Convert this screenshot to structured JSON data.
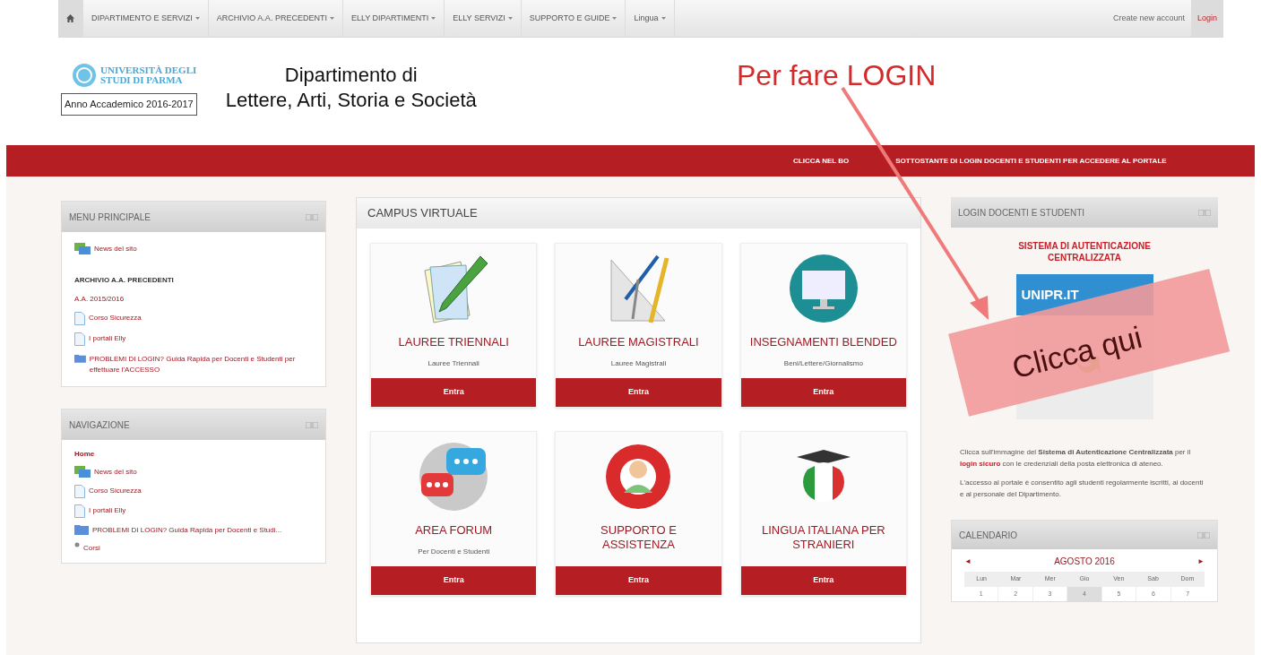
{
  "navbar": {
    "items": [
      {
        "kind": "home",
        "selected": true
      },
      {
        "kind": "menu",
        "label": "DIPARTIMENTO E SERVIZI"
      },
      {
        "kind": "menu",
        "label": "ARCHIVIO A.A. PRECEDENTI"
      },
      {
        "kind": "menu",
        "label": "ELLY DIPARTIMENTI"
      },
      {
        "kind": "menu",
        "label": "ELLY SERVIZI"
      },
      {
        "kind": "menu",
        "label": "SUPPORTO E GUIDE"
      },
      {
        "kind": "menu",
        "label": "Lingua"
      }
    ],
    "right_links": [
      {
        "label": "Create new account",
        "highlighted": false
      },
      {
        "label": "Login",
        "highlighted": true
      }
    ]
  },
  "header": {
    "logo_text": [
      "UNIVERSITÀ DEGLI",
      "STUDI DI PARMA"
    ],
    "academic_year": "Anno Accademico 2016-2017",
    "title": [
      "Dipartimento di",
      "Lettere, Arti, Storia e Società"
    ]
  },
  "banner": [
    "CLICCA NEL BO",
    "SOTTOSTANTE DI LOGIN DOCENTI E STUDENTI PER ACCEDERE AL PORTALE"
  ],
  "main_menu": {
    "title": "MENU PRINCIPALE",
    "items": [
      {
        "kind": "forum",
        "label": "News del sito"
      },
      {
        "kind": "heading",
        "label": "ARCHIVIO A.A. PRECEDENTI"
      },
      {
        "kind": "link",
        "label": "A.A. 2015/2016"
      },
      {
        "kind": "page",
        "label": "Corso Sicurezza"
      },
      {
        "kind": "page",
        "label": "I portali Elly"
      },
      {
        "kind": "folder",
        "label": "PROBLEMI DI LOGIN? Guida Rapida per Docenti e Studenti per effettuare l'ACCESSO"
      }
    ]
  },
  "navigation": {
    "title": "NAVIGAZIONE",
    "items": [
      {
        "kind": "home",
        "label": "Home"
      },
      {
        "kind": "forum",
        "label": "News del sito"
      },
      {
        "kind": "page",
        "label": "Corso Sicurezza"
      },
      {
        "kind": "page",
        "label": "I portali Elly"
      },
      {
        "kind": "folder",
        "label": "PROBLEMI DI LOGIN? Guida Rapida per Docenti e Studi..."
      },
      {
        "kind": "bullet",
        "label": "Corsi"
      }
    ]
  },
  "campus": {
    "title": "CAMPUS VIRTUALE",
    "tiles": [
      {
        "kind": "pencil",
        "title": "LAUREE TRIENNALI",
        "subtitle": "Lauree Triennali",
        "button": "Entra"
      },
      {
        "kind": "compass",
        "title": "LAUREE MAGISTRALI",
        "subtitle": "Lauree Magistrali",
        "button": "Entra"
      },
      {
        "kind": "monitor",
        "title": "INSEGNAMENTI BLENDED",
        "subtitle": "Beni/Lettere/Giornalismo",
        "button": "Entra"
      },
      {
        "kind": "chat",
        "title": "AREA FORUM",
        "subtitle": "Per Docenti e Studenti",
        "button": "Entra"
      },
      {
        "kind": "lifebuoy",
        "title": "SUPPORTO E ASSISTENZA",
        "button": "Entra"
      },
      {
        "kind": "flag",
        "title": "LINGUA ITALIANA PER STRANIERI",
        "button": "Entra"
      }
    ]
  },
  "login_block": {
    "title": "LOGIN DOCENTI E STUDENTI",
    "heading": "SISTEMA DI AUTENTICAZIONE CENTRALIZZATA",
    "image_brand": "UNIPR.IT",
    "paragraph_before": "Clicca sull'immagine del **Sistema di Autenticazione Centralizzata** per il",
    "paragraph_link": "login sicuro",
    "paragraph_after": "con le credenziali della posta elettronica di ateneo.",
    "paragraph_2": "L'accesso al portale è consentito agli studenti regolarmente iscritti, ai docenti e al personale del Dipartimento."
  },
  "calendar": {
    "title": "CALENDARIO",
    "prev": "◄",
    "month": "AGOSTO 2016",
    "next": "►",
    "weekdays": [
      "Lun",
      "Mar",
      "Mer",
      "Gio",
      "Ven",
      "Sab",
      "Dom"
    ],
    "days": [
      {
        "day": "1",
        "today": false
      },
      {
        "day": "2",
        "today": false
      },
      {
        "day": "3",
        "today": false
      },
      {
        "day": "4",
        "today": true
      },
      {
        "day": "5",
        "today": false
      },
      {
        "day": "6",
        "today": false
      },
      {
        "day": "7",
        "today": false
      }
    ]
  },
  "annotations": {
    "caption": "Per fare LOGIN",
    "sticker": "Clicca qui"
  }
}
